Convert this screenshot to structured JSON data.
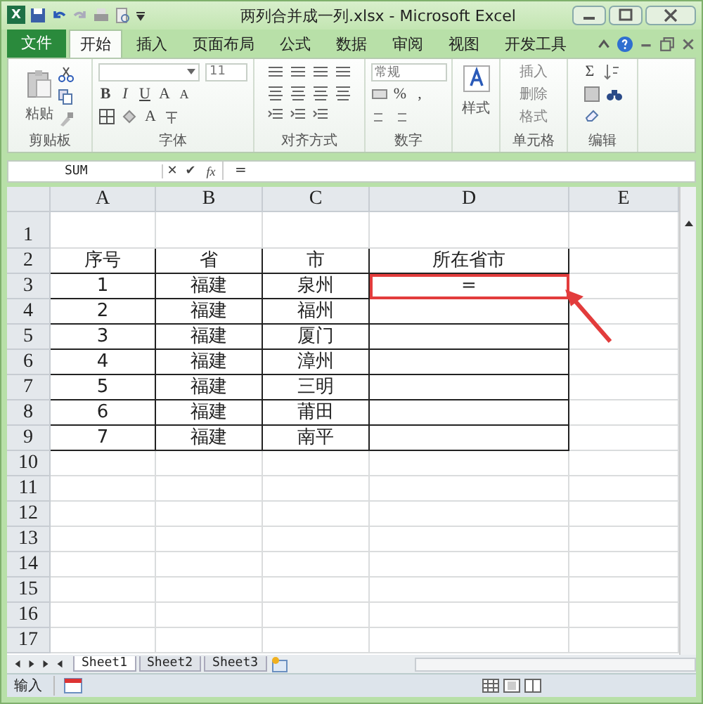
{
  "window": {
    "app_icon": "X",
    "title": "两列合并成一列.xlsx - Microsoft Excel"
  },
  "ribbon_tabs": [
    {
      "label": "文件",
      "kind": "file",
      "selected": false
    },
    {
      "label": "开始",
      "kind": "tab",
      "selected": true
    },
    {
      "label": "插入",
      "kind": "tab",
      "selected": false
    },
    {
      "label": "页面布局",
      "kind": "tab",
      "selected": false
    },
    {
      "label": "公式",
      "kind": "tab",
      "selected": false
    },
    {
      "label": "数据",
      "kind": "tab",
      "selected": false
    },
    {
      "label": "审阅",
      "kind": "tab",
      "selected": false
    },
    {
      "label": "视图",
      "kind": "tab",
      "selected": false
    },
    {
      "label": "开发工具",
      "kind": "tab",
      "selected": false
    }
  ],
  "ribbon": {
    "clipboard": {
      "label": "剪贴板",
      "paste": "粘贴"
    },
    "font": {
      "label": "字体",
      "size": "11",
      "bold": "B",
      "italic": "I",
      "underline": "U",
      "grow": "A",
      "shrink": "A",
      "font_color": "A"
    },
    "alignment": {
      "label": "对齐方式"
    },
    "number": {
      "label": "数字",
      "format": "常规",
      "percent": "%",
      "comma": ","
    },
    "styles": {
      "button": "样式"
    },
    "cells": {
      "label": "单元格",
      "insert": "插入",
      "delete": "删除",
      "format": "格式"
    },
    "editing": {
      "label": "编辑",
      "sum": "Σ"
    }
  },
  "formula_bar": {
    "name_box": "SUM",
    "cancel": "✕",
    "enter": "✔",
    "function": "fx",
    "formula": "="
  },
  "sheet": {
    "columns": [
      "A",
      "B",
      "C",
      "D",
      "E"
    ],
    "rows": [
      {
        "number": "1",
        "bordered": false
      },
      {
        "number": "2",
        "bordered": true,
        "cells": [
          {
            "text": "序号",
            "selected": false
          },
          {
            "text": "省",
            "selected": false
          },
          {
            "text": "市",
            "selected": false
          },
          {
            "text": "所在省市",
            "selected": false
          }
        ]
      },
      {
        "number": "3",
        "bordered": true,
        "cells": [
          {
            "text": "1",
            "selected": false
          },
          {
            "text": "福建",
            "selected": false
          },
          {
            "text": "泉州",
            "selected": false
          },
          {
            "text": "=",
            "selected": true
          }
        ]
      },
      {
        "number": "4",
        "bordered": true,
        "cells": [
          {
            "text": "2",
            "selected": false
          },
          {
            "text": "福建",
            "selected": false
          },
          {
            "text": "福州",
            "selected": false
          }
        ]
      },
      {
        "number": "5",
        "bordered": true,
        "cells": [
          {
            "text": "3",
            "selected": false
          },
          {
            "text": "福建",
            "selected": false
          },
          {
            "text": "厦门",
            "selected": false
          }
        ]
      },
      {
        "number": "6",
        "bordered": true,
        "cells": [
          {
            "text": "4",
            "selected": false
          },
          {
            "text": "福建",
            "selected": false
          },
          {
            "text": "漳州",
            "selected": false
          }
        ]
      },
      {
        "number": "7",
        "bordered": true,
        "cells": [
          {
            "text": "5",
            "selected": false
          },
          {
            "text": "福建",
            "selected": false
          },
          {
            "text": "三明",
            "selected": false
          }
        ]
      },
      {
        "number": "8",
        "bordered": true,
        "cells": [
          {
            "text": "6",
            "selected": false
          },
          {
            "text": "福建",
            "selected": false
          },
          {
            "text": "莆田",
            "selected": false
          }
        ]
      },
      {
        "number": "9",
        "bordered": true,
        "cells": [
          {
            "text": "7",
            "selected": false
          },
          {
            "text": "福建",
            "selected": false
          },
          {
            "text": "南平",
            "selected": false
          }
        ]
      },
      {
        "number": "10",
        "bordered": false
      },
      {
        "number": "11",
        "bordered": false
      },
      {
        "number": "12",
        "bordered": false
      },
      {
        "number": "13",
        "bordered": false
      },
      {
        "number": "14",
        "bordered": false
      },
      {
        "number": "15",
        "bordered": false
      },
      {
        "number": "16",
        "bordered": false
      },
      {
        "number": "17",
        "bordered": false
      }
    ]
  },
  "sheet_tabs": [
    {
      "label": "Sheet1",
      "selected": true
    },
    {
      "label": "Sheet2",
      "selected": false
    },
    {
      "label": "Sheet3",
      "selected": false
    }
  ],
  "status_bar": {
    "mode": "输入"
  }
}
